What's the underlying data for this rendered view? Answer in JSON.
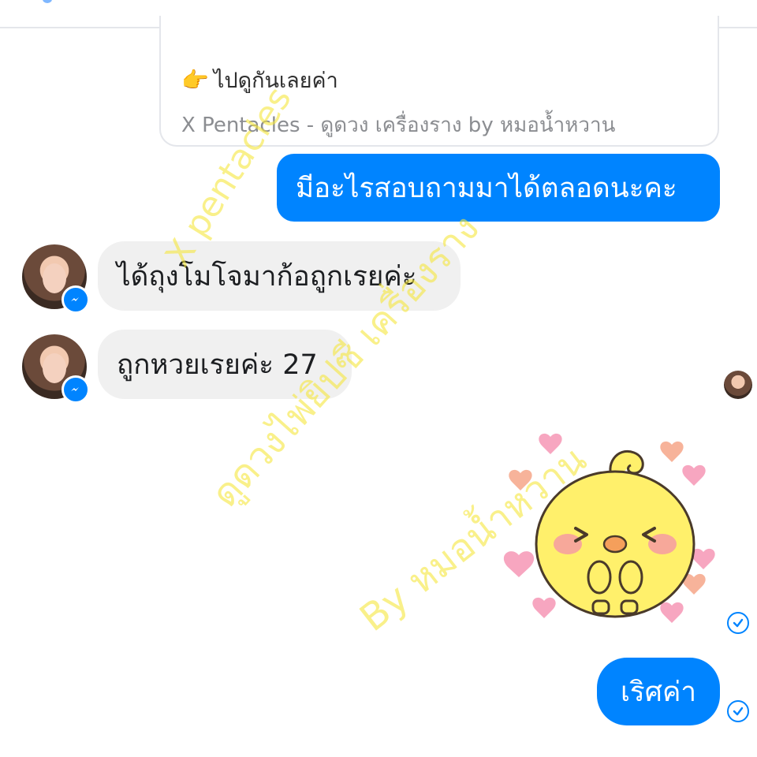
{
  "link_preview": {
    "title": "ไปดูกันเลยค่า",
    "subtitle": "X Pentacles - ดูดวง เครื่องราง by หมอน้ำหวาน",
    "icon": "pointing-hand-icon"
  },
  "messages": [
    {
      "id": "m1",
      "direction": "outgoing",
      "text": "มีอะไรสอบถามมาได้ตลอดนะคะ"
    },
    {
      "id": "m2",
      "direction": "incoming",
      "text": "ได้ถุงโมโจมาก้อถูกเรยค่ะ"
    },
    {
      "id": "m3",
      "direction": "incoming",
      "text": "ถูกหวยเรยค่ะ 27"
    },
    {
      "id": "m4",
      "direction": "outgoing",
      "type": "sticker",
      "sticker": "yellow-chick-with-hearts"
    },
    {
      "id": "m5",
      "direction": "outgoing",
      "text": "เริศค่า"
    }
  ],
  "colors": {
    "outgoing_bubble": "#0084ff",
    "incoming_bubble": "#f0f0f0",
    "watermark": "#f5e63c"
  },
  "watermark": {
    "line1": "X pentacles",
    "line2": "ดูดวงไพ่ยิปซี เครื่องราง",
    "line3": "By หมอน้ำหวาน"
  }
}
